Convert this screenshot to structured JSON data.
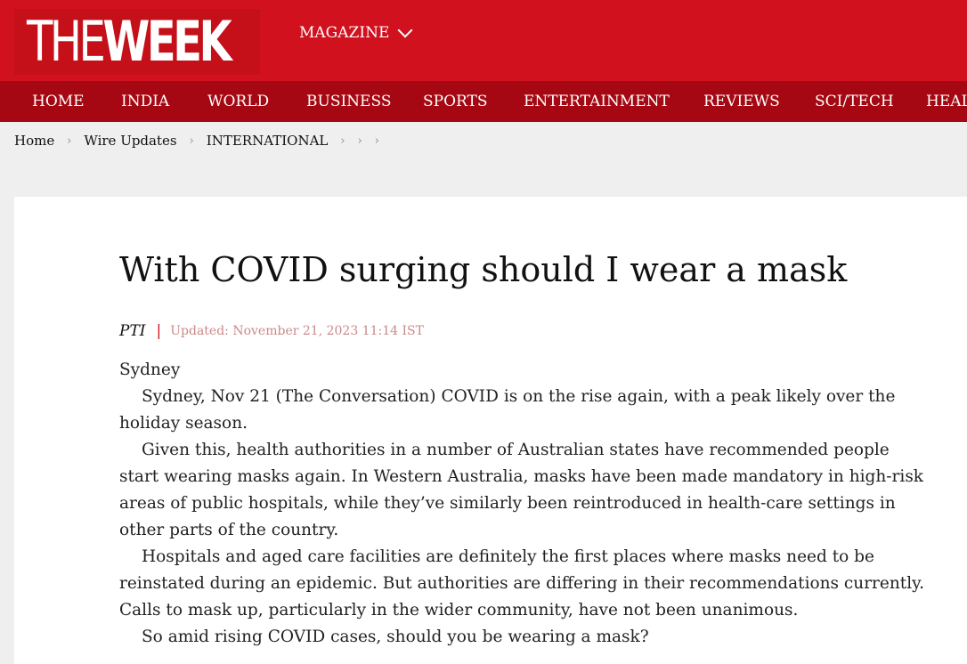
{
  "header": {
    "logo_the": "THE",
    "logo_week": "WEEK",
    "magazine_label": "MAGAZINE"
  },
  "nav": {
    "items": [
      "HOME",
      "INDIA",
      "WORLD",
      "BUSINESS",
      "SPORTS",
      "ENTERTAINMENT",
      "REVIEWS",
      "SCI/TECH",
      "HEAL"
    ]
  },
  "breadcrumb": [
    "Home",
    "Wire Updates",
    "INTERNATIONAL"
  ],
  "article": {
    "title": "With COVID surging should I wear a mask",
    "author": "PTI",
    "separator": "|",
    "updated": "Updated: November 21, 2023 11:14 IST",
    "dateline": "Sydney",
    "paragraphs": [
      "Sydney, Nov 21 (The Conversation) COVID is on the rise again, with a peak likely over the holiday season.",
      "Given this, health authorities in a number of Australian states have recommended people start wearing masks again. In Western Australia, masks have been made mandatory in high-risk areas of public hospitals, while they’ve similarly been reintroduced in health-care settings in other parts of the country.",
      "Hospitals and aged care facilities are definitely the first places where masks need to be reinstated during an epidemic. But authorities are differing in their recommendations currently. Calls to mask up, particularly in the wider community, have not been unanimous.",
      "So amid rising COVID cases, should you be wearing a mask?"
    ]
  },
  "colors": {
    "brand_red": "#d2111e",
    "nav_red": "#a50812",
    "date_color": "#c98a8a",
    "page_bg": "#efefef"
  },
  "icons": {
    "magazine_dropdown": "chevron-down-icon",
    "breadcrumb_separator": "chevron-right-icon"
  }
}
